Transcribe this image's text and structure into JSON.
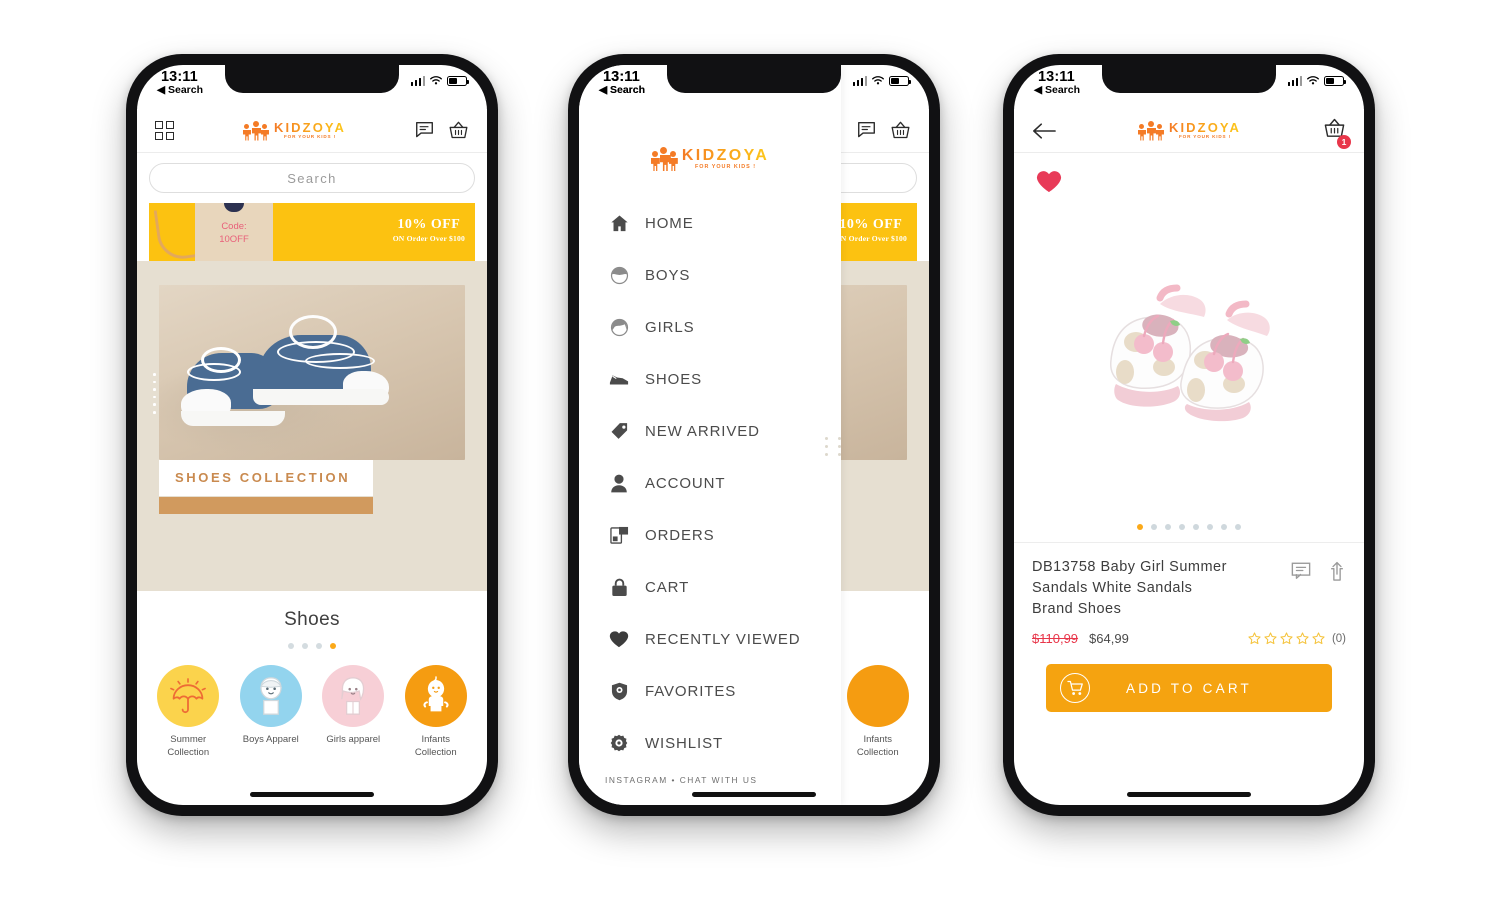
{
  "status_bar": {
    "time": "13:11",
    "back_label": "Search"
  },
  "brand": {
    "name": "KIDZOYA",
    "tagline": "FOR YOUR KIDS !"
  },
  "phone1": {
    "header": {
      "grid_icon": "grid-icon",
      "chat_icon": "chat-icon",
      "cart_icon": "basket-icon"
    },
    "search": {
      "placeholder": "Search",
      "value": "Search"
    },
    "promo": {
      "code_label": "Code:",
      "code_value": "10OFF",
      "headline": "10% OFF",
      "sub": "ON Order Over $100"
    },
    "hero": {
      "label": "SHOES COLLECTION"
    },
    "section": {
      "title": "Shoes",
      "dot_count": 4,
      "dot_active": 3
    },
    "categories": [
      {
        "label": "Summer\nCollection",
        "label_line1": "Summer",
        "label_line2": "Collection",
        "color": "#FBD34C",
        "icon": "umbrella-icon"
      },
      {
        "label": "Boys Apparel",
        "label_line1": "Boys Apparel",
        "label_line2": "",
        "color": "#93D4EE",
        "icon": "boy-icon"
      },
      {
        "label": "Girls apparel",
        "label_line1": "Girls apparel",
        "label_line2": "",
        "color": "#F7CFD6",
        "icon": "girl-icon"
      },
      {
        "label": "Infants\nCollection",
        "label_line1": "Infants",
        "label_line2": "Collection",
        "color": "#F59C11",
        "icon": "baby-icon"
      }
    ]
  },
  "phone2": {
    "menu": [
      {
        "label": "HOME",
        "icon": "home-icon"
      },
      {
        "label": "BOYS",
        "icon": "boy-head-icon"
      },
      {
        "label": "GIRLS",
        "icon": "girl-head-icon"
      },
      {
        "label": "SHOES",
        "icon": "shoe-icon"
      },
      {
        "label": "NEW ARRIVED",
        "icon": "tag-icon"
      },
      {
        "label": "ACCOUNT",
        "icon": "person-icon"
      },
      {
        "label": "ORDERS",
        "icon": "orders-icon"
      },
      {
        "label": "CART",
        "icon": "lock-bag-icon"
      },
      {
        "label": "RECENTLY VIEWED",
        "icon": "heart-icon"
      },
      {
        "label": "FAVORITES",
        "icon": "shield-icon"
      },
      {
        "label": "WISHLIST",
        "icon": "gear-icon"
      }
    ],
    "footer": "INSTAGRAM  •  CHAT WITH US"
  },
  "phone3": {
    "header": {
      "back_icon": "back-arrow-icon",
      "cart_icon": "basket-icon",
      "cart_count": "1"
    },
    "favorite_icon": "heart-filled-icon",
    "carousel": {
      "dot_count": 8,
      "dot_active": 0
    },
    "product": {
      "title": "DB13758 Baby Girl Summer Sandals White Sandals Brand Shoes",
      "old_price": "$110,99",
      "new_price": "$64,99",
      "rating_stars": 0,
      "rating_count": "(0)",
      "review_icon": "review-icon",
      "share_icon": "share-icon"
    },
    "add_to_cart": "ADD TO CART"
  },
  "colors": {
    "brand_orange": "#F47B26",
    "brand_yellow": "#FCC81B",
    "accent": "#FBA919",
    "banner_yellow": "#FCC211",
    "hero_beige": "#E6DFD1",
    "copper": "#D19A5E",
    "red": "#E8364A"
  }
}
